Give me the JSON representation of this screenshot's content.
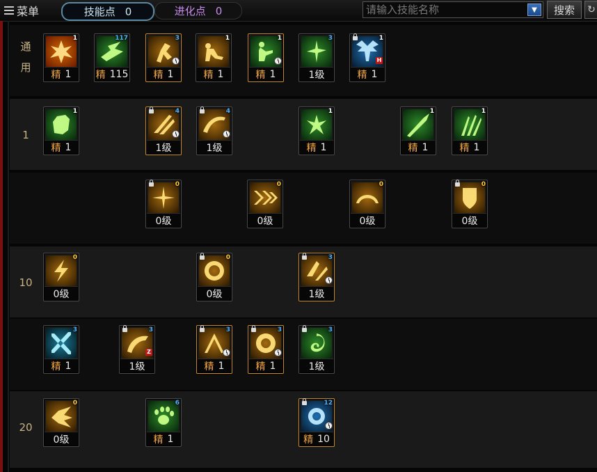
{
  "toolbar": {
    "menu_label": "菜单",
    "skill_points_label": "技能点",
    "skill_points_value": "0",
    "evolution_points_label": "进化点",
    "evolution_points_value": "0",
    "search_placeholder": "请输入技能名称",
    "search_button_label": "搜索"
  },
  "rows": [
    {
      "label": "通\n用",
      "skills": [
        {
          "level_type": "精",
          "level_value": "1",
          "tag": "1",
          "tag_color": "white",
          "icon": "explosion-icon",
          "hue": "fire"
        },
        {
          "level_type": "精",
          "level_value": "115",
          "tag": "117",
          "tag_color": "blue",
          "icon": "dash-strike-icon",
          "hue": "green"
        },
        {
          "level_type": "精",
          "level_value": "1",
          "tag": "3",
          "tag_color": "blue",
          "icon": "leg-kick-icon",
          "hue": "gold",
          "frame": "gold",
          "clock": true
        },
        {
          "level_type": "精",
          "level_value": "1",
          "tag": "1",
          "tag_color": "white",
          "icon": "crouch-icon",
          "hue": "gold"
        },
        {
          "level_type": "精",
          "level_value": "1",
          "tag": "1",
          "tag_color": "white",
          "icon": "sit-recover-icon",
          "hue": "green",
          "frame": "gold",
          "clock": true
        },
        {
          "level_type": "",
          "level_value": "1级",
          "tag": "3",
          "tag_color": "blue",
          "icon": "crosshair-icon",
          "hue": "green"
        },
        {
          "level_type": "精",
          "level_value": "1",
          "tag": "1",
          "tag_color": "white",
          "icon": "wing-up-icon",
          "hue": "blue",
          "lock": true,
          "badge": "H"
        }
      ]
    },
    {
      "label": "1",
      "skills": [
        {
          "level_type": "精",
          "level_value": "1",
          "tag": "1",
          "tag_color": "white",
          "icon": "grab-icon",
          "hue": "green"
        },
        {
          "level_type": "",
          "level_value": "1级",
          "tag": "4",
          "tag_color": "blue",
          "icon": "slash-claw-icon",
          "hue": "gold",
          "frame": "gold",
          "lock": true,
          "clock": true
        },
        {
          "level_type": "",
          "level_value": "1级",
          "tag": "4",
          "tag_color": "blue",
          "icon": "sweep-slash-icon",
          "hue": "gold",
          "lock": true,
          "clock": true
        },
        {
          "level_type": "精",
          "level_value": "1",
          "tag": "1",
          "tag_color": "white",
          "icon": "spark-burst-icon",
          "hue": "green"
        },
        {
          "level_type": "精",
          "level_value": "1",
          "tag": "1",
          "tag_color": "white",
          "icon": "light-beam-icon",
          "hue": "green"
        },
        {
          "level_type": "精",
          "level_value": "1",
          "tag": "1",
          "tag_color": "white",
          "icon": "triple-blade-icon",
          "hue": "green"
        }
      ]
    },
    {
      "label": "",
      "skills": [
        {
          "level_type": "",
          "level_value": "0级",
          "tag": "0",
          "tag_color": "gold",
          "icon": "star-burst-icon",
          "hue": "gold",
          "lock": true
        },
        {
          "level_type": "",
          "level_value": "0级",
          "tag": "0",
          "tag_color": "gold",
          "icon": "chevron-arrows-icon",
          "hue": "gold"
        },
        {
          "level_type": "",
          "level_value": "0级",
          "tag": "0",
          "tag_color": "gold",
          "icon": "arc-wave-icon",
          "hue": "gold"
        },
        {
          "level_type": "",
          "level_value": "0级",
          "tag": "0",
          "tag_color": "gold",
          "icon": "cross-shield-icon",
          "hue": "gold",
          "lock": true
        }
      ]
    },
    {
      "label": "10",
      "skills": [
        {
          "level_type": "",
          "level_value": "0级",
          "tag": "0",
          "tag_color": "gold",
          "icon": "lightning-icon",
          "hue": "gold"
        },
        {
          "level_type": "",
          "level_value": "0级",
          "tag": "0",
          "tag_color": "gold",
          "icon": "spin-circle-icon",
          "hue": "gold",
          "lock": true
        },
        {
          "level_type": "",
          "level_value": "1级",
          "tag": "3",
          "tag_color": "blue",
          "icon": "flurry-icon",
          "hue": "gold",
          "frame": "gold",
          "lock": true,
          "clock": true
        }
      ]
    },
    {
      "label": "",
      "skills": [
        {
          "level_type": "精",
          "level_value": "1",
          "tag": "3",
          "tag_color": "blue",
          "icon": "cross-blade-icon",
          "hue": "cyan"
        },
        {
          "level_type": "",
          "level_value": "1级",
          "tag": "3",
          "tag_color": "blue",
          "icon": "swirl-slash-icon",
          "hue": "gold",
          "lock": true,
          "badge": "Z"
        },
        {
          "level_type": "精",
          "level_value": "1",
          "tag": "3",
          "tag_color": "blue",
          "icon": "tent-strike-icon",
          "hue": "gold",
          "frame": "gold",
          "lock": true,
          "clock": true
        },
        {
          "level_type": "精",
          "level_value": "1",
          "tag": "3",
          "tag_color": "blue",
          "icon": "ring-spin-icon",
          "hue": "gold",
          "frame": "gold",
          "lock": true,
          "clock": true
        },
        {
          "level_type": "",
          "level_value": "1级",
          "tag": "3",
          "tag_color": "blue",
          "icon": "vortex-icon",
          "hue": "green",
          "lock": true
        }
      ]
    },
    {
      "label": "20",
      "skills": [
        {
          "level_type": "",
          "level_value": "0级",
          "tag": "0",
          "tag_color": "gold",
          "icon": "palm-blast-icon",
          "hue": "gold"
        },
        {
          "level_type": "精",
          "level_value": "1",
          "tag": "6",
          "tag_color": "blue",
          "icon": "paw-icon",
          "hue": "green"
        },
        {
          "level_type": "精",
          "level_value": "10",
          "tag": "12",
          "tag_color": "blue",
          "icon": "orbit-icon",
          "hue": "blue",
          "frame": "gold",
          "lock": true,
          "clock": true
        }
      ]
    }
  ]
}
